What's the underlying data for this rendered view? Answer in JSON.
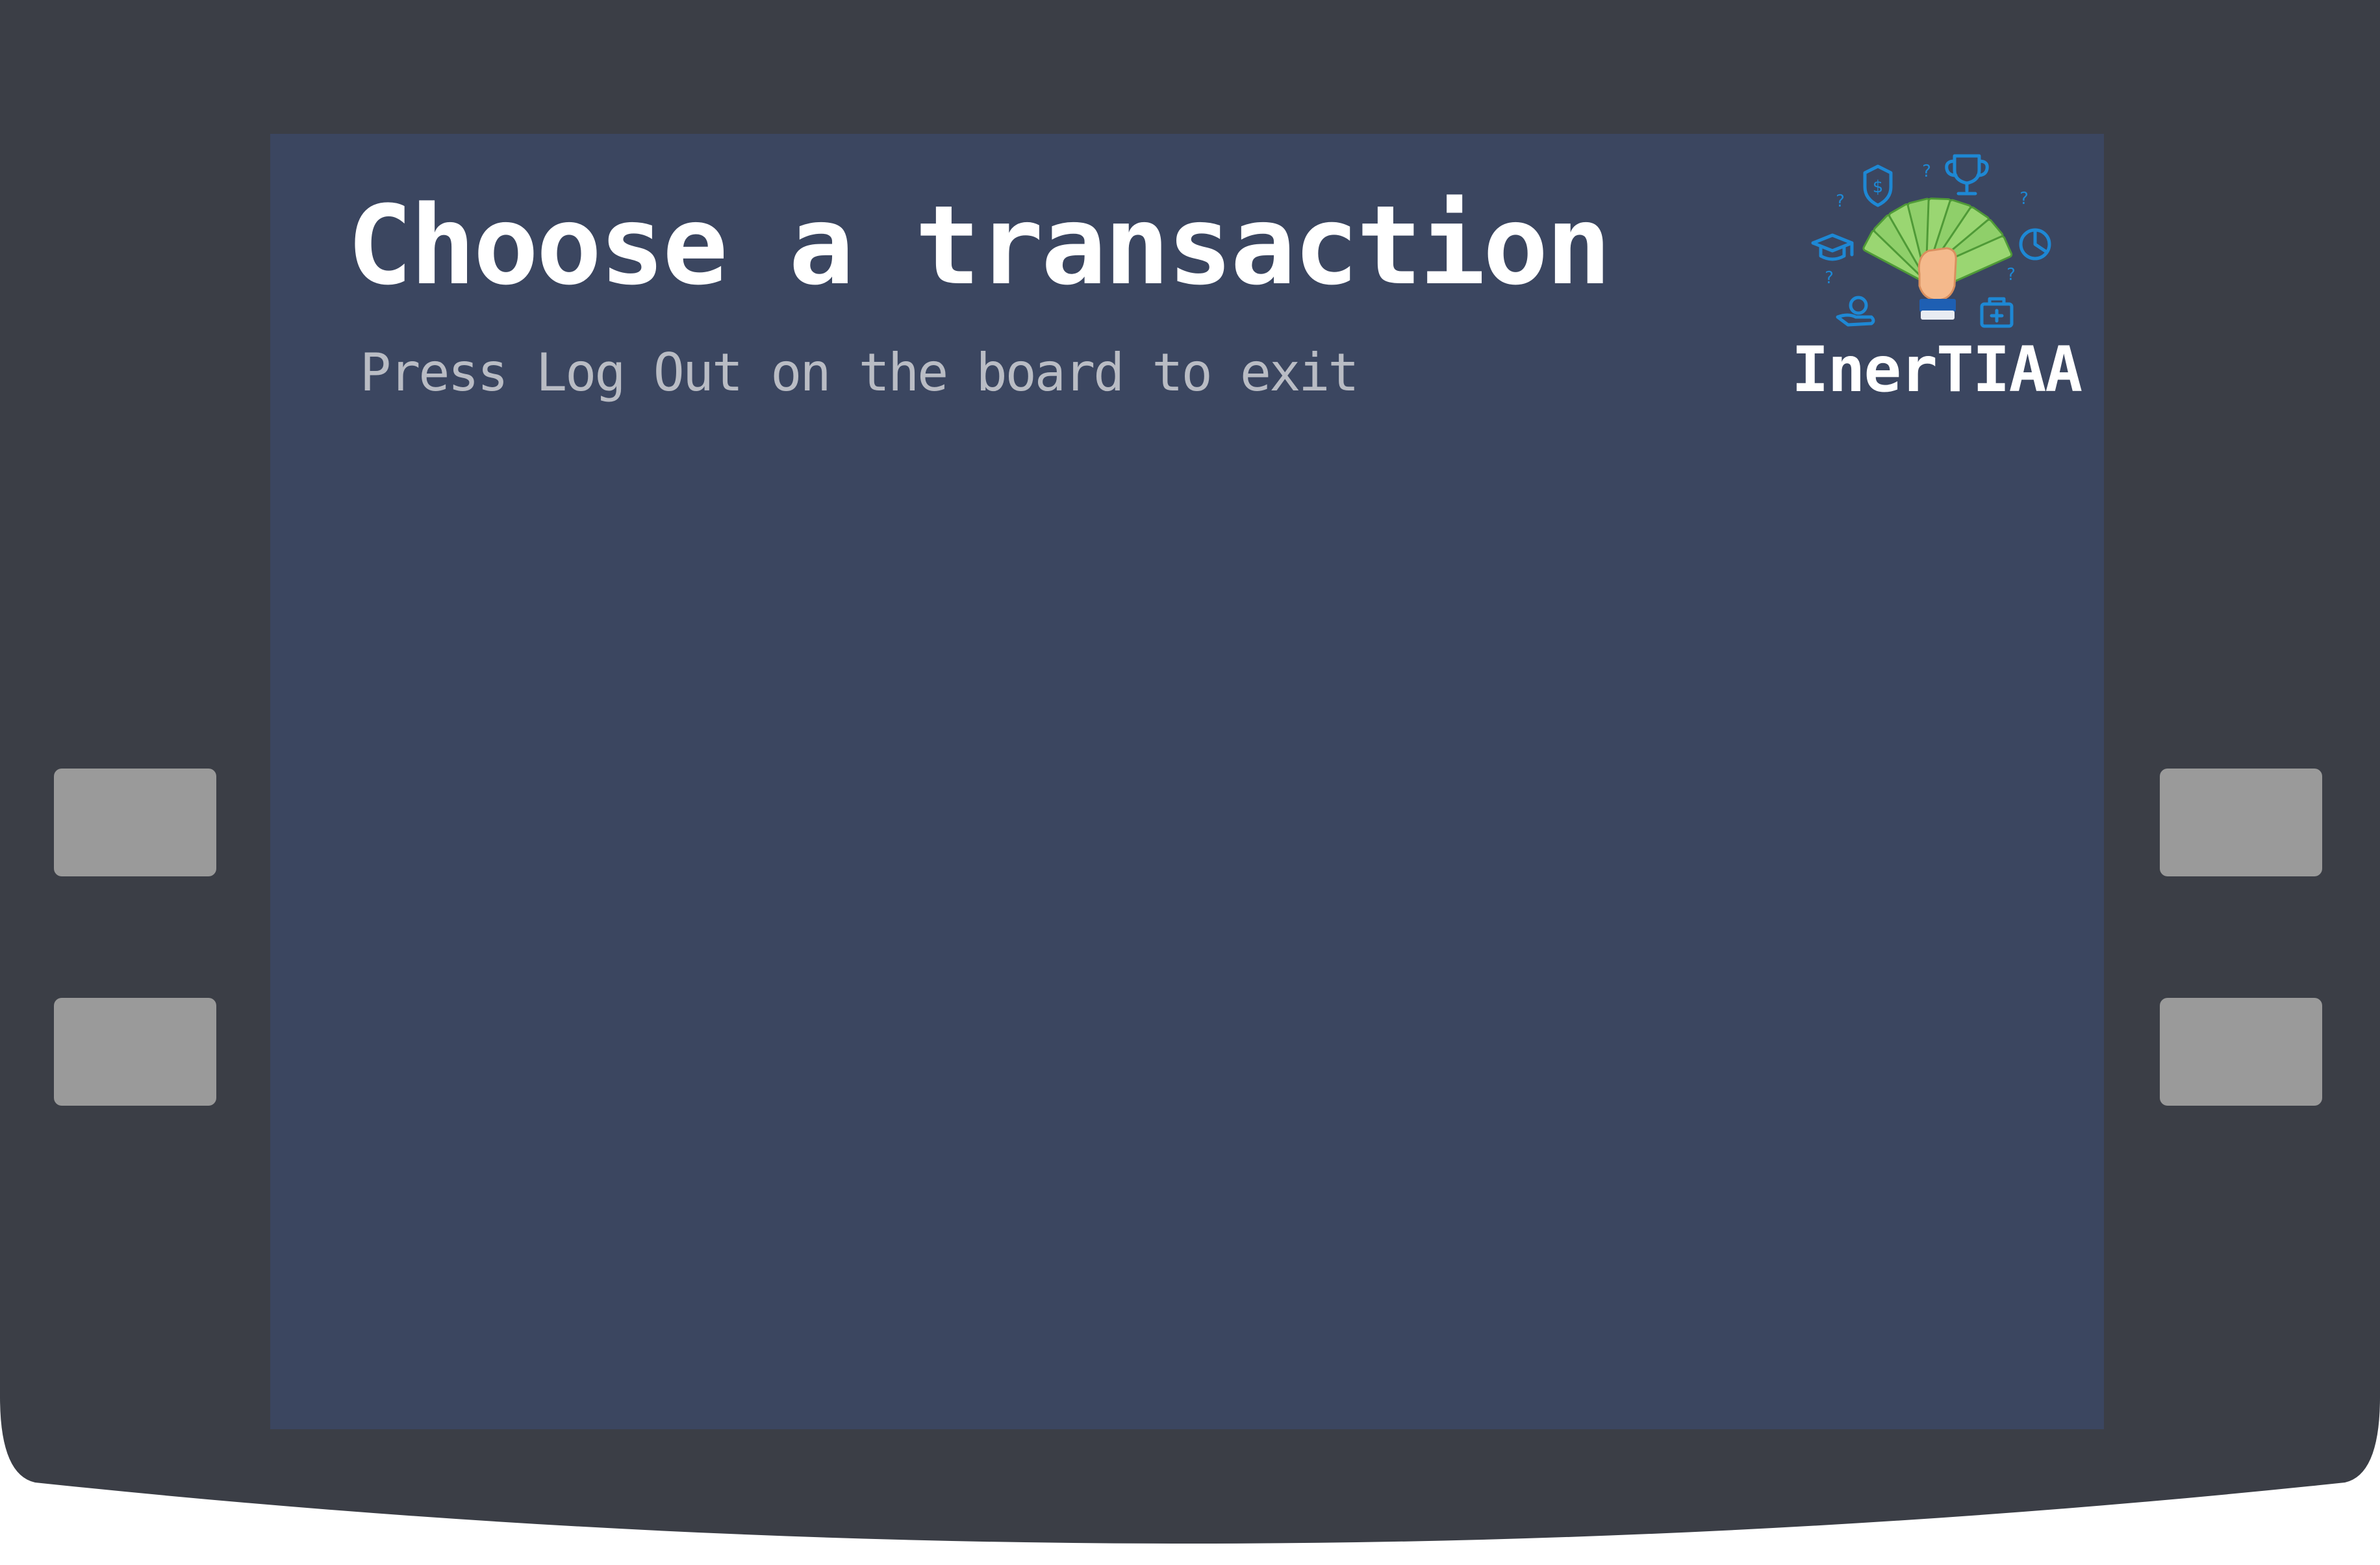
{
  "screen": {
    "title": "Choose a transaction",
    "subtitle": "Press Log Out on the board to exit"
  },
  "logo": {
    "brand_text": "InerTIAA",
    "icons": [
      "shield-dollar-icon",
      "trophy-icon",
      "graduation-cap-icon",
      "pie-chart-icon",
      "hand-coin-icon",
      "medical-kit-icon",
      "question-mark-icon",
      "money-fan-icon"
    ]
  },
  "side_buttons": {
    "left": [
      "",
      ""
    ],
    "right": [
      "",
      ""
    ]
  },
  "colors": {
    "atm_body": "#3b3e46",
    "screen_background": "#3b4660",
    "side_button": "#9a9a9a",
    "title_text": "#ffffff",
    "subtitle_text": "#b9bcc4",
    "logo_icon_blue": "#1e88d4",
    "money_green": "#8fcf6a"
  }
}
